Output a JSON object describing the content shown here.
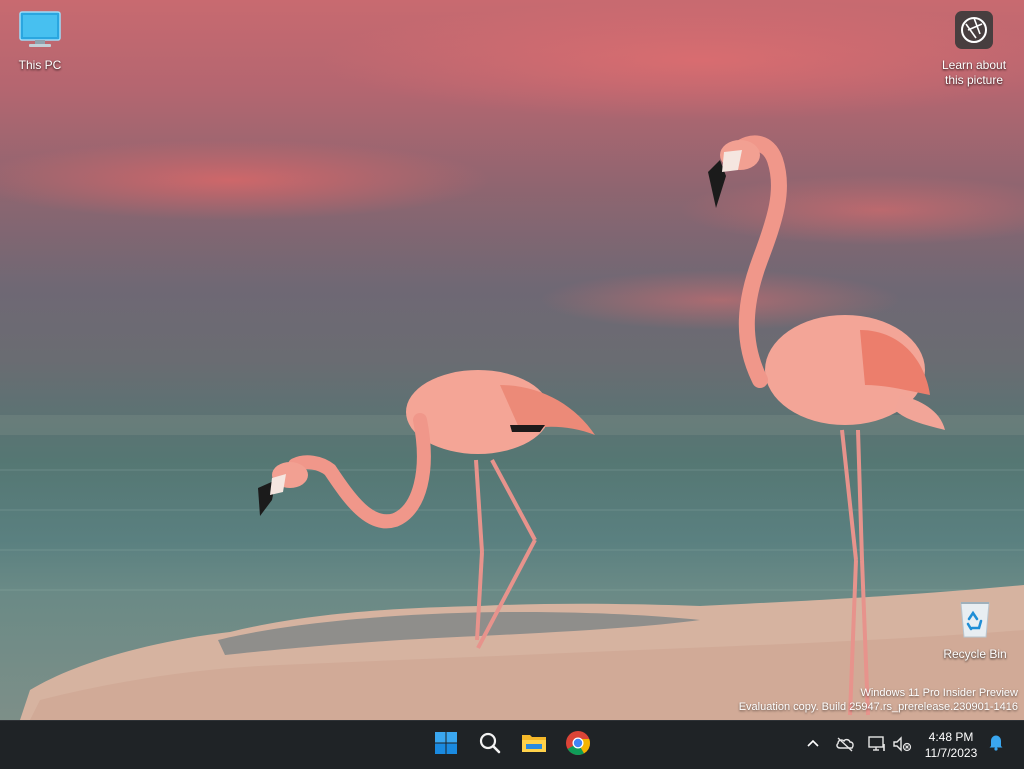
{
  "desktop": {
    "icons": [
      {
        "label": "This PC",
        "icon": "monitor-icon"
      },
      {
        "label_line1": "Learn about",
        "label_line2": "this picture",
        "icon": "camera-lens-icon"
      },
      {
        "label": "Recycle Bin",
        "icon": "recycle-bin-icon"
      }
    ],
    "watermark": {
      "line1": "Windows 11 Pro Insider Preview",
      "line2": "Evaluation copy. Build 25947.rs_prerelease.230901-1416"
    }
  },
  "taskbar": {
    "apps": [
      {
        "icon": "windows-start-icon"
      },
      {
        "icon": "search-icon"
      },
      {
        "icon": "file-explorer-icon"
      },
      {
        "icon": "chrome-icon"
      }
    ],
    "tray": {
      "icons": [
        "chevron-up-icon",
        "onedrive-offline-icon",
        "network-icon",
        "volume-muted-icon",
        "bell-icon"
      ],
      "time": "4:48 PM",
      "date": "11/7/2023"
    }
  },
  "colors": {
    "taskbar_bg": "#1f2326",
    "accent": "#0f7bd6",
    "flamingo": "#f1a08f",
    "sky_pink": "#d8727a",
    "water": "#5a7f7e",
    "sand": "#d9b5a2"
  }
}
